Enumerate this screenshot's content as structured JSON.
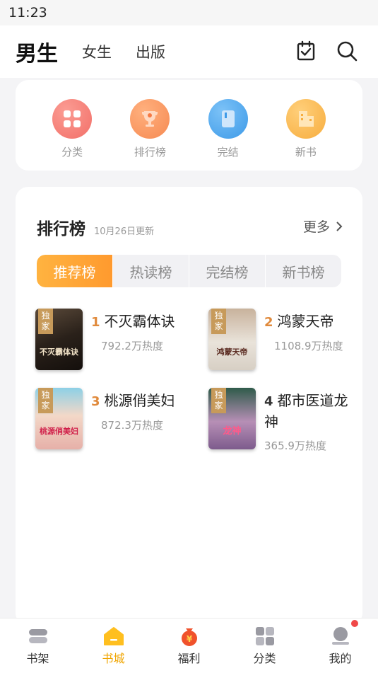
{
  "status": {
    "time": "11:23"
  },
  "top_nav": {
    "tabs": [
      {
        "label": "男生"
      },
      {
        "label": "女生"
      },
      {
        "label": "出版"
      }
    ],
    "icons": [
      "calendar-check-icon",
      "search-icon"
    ]
  },
  "categories": [
    {
      "label": "分类",
      "icon": "grid-icon",
      "color": "#f47a72"
    },
    {
      "label": "排行榜",
      "icon": "trophy-icon",
      "color": "#f8965a"
    },
    {
      "label": "完结",
      "icon": "book-icon",
      "color": "#4ea7ef"
    },
    {
      "label": "新书",
      "icon": "building-icon",
      "color": "#f8b548"
    }
  ],
  "ranking": {
    "title": "排行榜",
    "update": "10月26日更新",
    "more": "更多",
    "tabs": [
      {
        "label": "推荐榜"
      },
      {
        "label": "热读榜"
      },
      {
        "label": "完结榜"
      },
      {
        "label": "新书榜"
      }
    ],
    "books": [
      {
        "rank": "1",
        "name": "不灭霸体诀",
        "heat": "792.2万热度",
        "badge": "独家",
        "cover_text": "不灭霸体诀"
      },
      {
        "rank": "2",
        "name": "鸿蒙天帝",
        "heat": "1108.9万热度",
        "badge": "独家",
        "cover_text": "鸿蒙天帝"
      },
      {
        "rank": "3",
        "name": "桃源俏美妇",
        "heat": "872.3万热度",
        "badge": "独家",
        "cover_text": "桃源俏美妇"
      },
      {
        "rank": "4",
        "name_line1": "都市医道龙",
        "name_line2": "神",
        "heat": "365.9万热度",
        "badge": "独家",
        "cover_text": "龙神"
      }
    ]
  },
  "bottom_nav": [
    {
      "label": "书架"
    },
    {
      "label": "书城"
    },
    {
      "label": "福利"
    },
    {
      "label": "分类"
    },
    {
      "label": "我的"
    }
  ],
  "colors": {
    "accent": "#ff9a2e",
    "rank_top": "#e08a3c",
    "rank_other": "#333333"
  }
}
